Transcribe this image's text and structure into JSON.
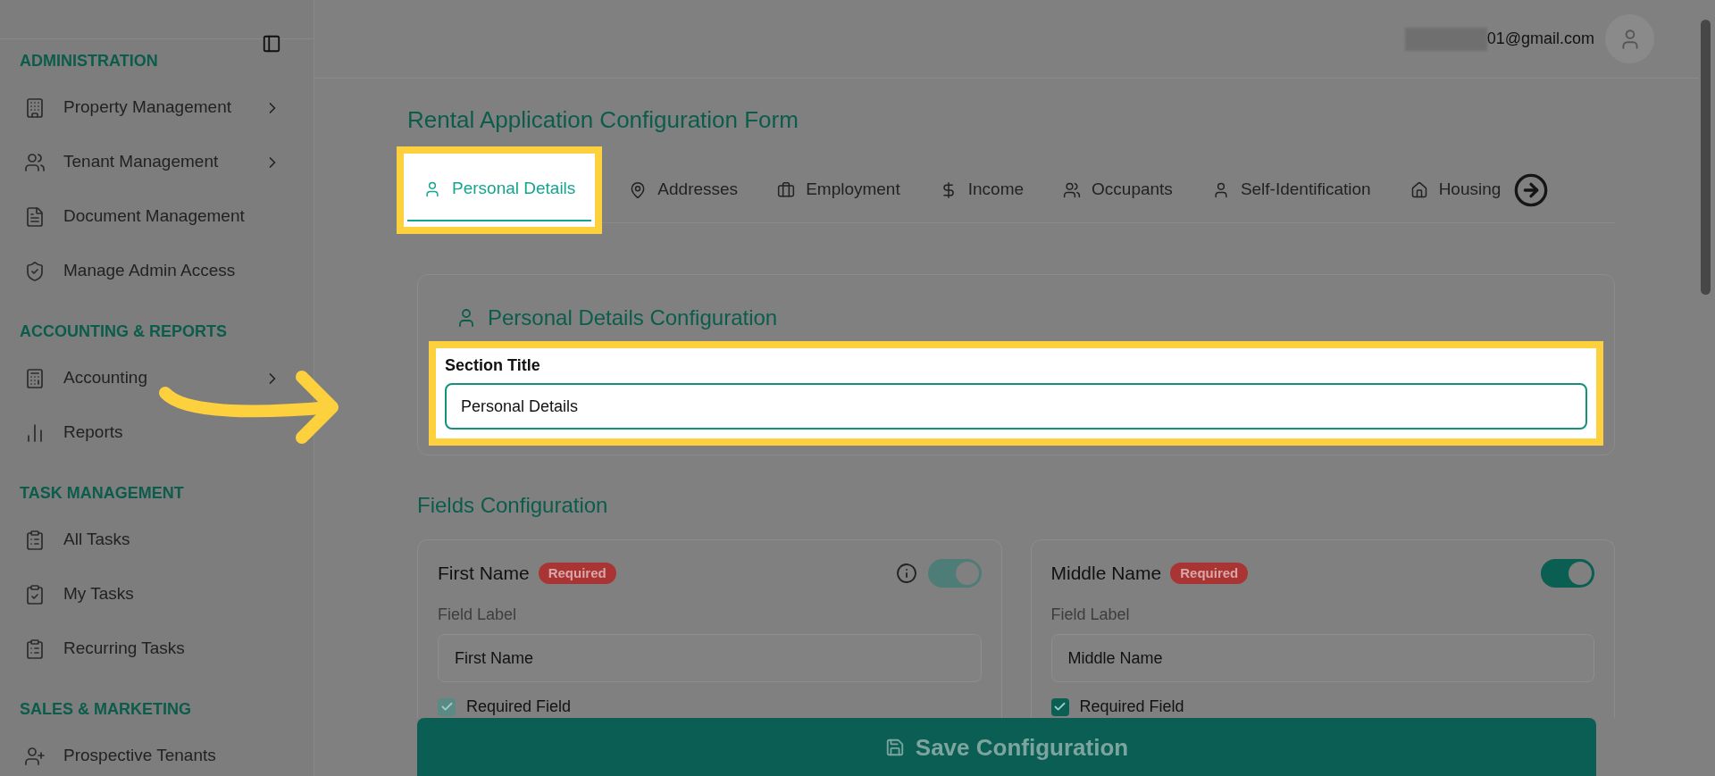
{
  "sidebar": {
    "sections": [
      {
        "heading": "ADMINISTRATION",
        "items": [
          {
            "label": "Property Management",
            "has_submenu": true
          },
          {
            "label": "Tenant Management",
            "has_submenu": true
          },
          {
            "label": "Document Management",
            "has_submenu": false
          },
          {
            "label": "Manage Admin Access",
            "has_submenu": false
          }
        ]
      },
      {
        "heading": "ACCOUNTING & REPORTS",
        "items": [
          {
            "label": "Accounting",
            "has_submenu": true
          },
          {
            "label": "Reports",
            "has_submenu": false
          }
        ]
      },
      {
        "heading": "TASK MANAGEMENT",
        "items": [
          {
            "label": "All Tasks",
            "has_submenu": false
          },
          {
            "label": "My Tasks",
            "has_submenu": false
          },
          {
            "label": "Recurring Tasks",
            "has_submenu": false
          }
        ]
      },
      {
        "heading": "SALES & MARKETING",
        "items": [
          {
            "label": "Prospective Tenants",
            "has_submenu": false
          }
        ]
      }
    ]
  },
  "header": {
    "user_email": "01@gmail.com"
  },
  "form": {
    "title": "Rental Application Configuration Form",
    "tabs": [
      {
        "label": "Personal Details",
        "selected": true
      },
      {
        "label": "Addresses",
        "selected": false
      },
      {
        "label": "Employment",
        "selected": false
      },
      {
        "label": "Income",
        "selected": false
      },
      {
        "label": "Occupants",
        "selected": false
      },
      {
        "label": "Self-Identification",
        "selected": false
      },
      {
        "label": "Housing",
        "selected": false
      }
    ],
    "section": {
      "heading": "Personal Details Configuration",
      "field_label": "Section Title",
      "value": "Personal Details",
      "highlighted": true
    },
    "fields_heading": "Fields Configuration",
    "fields": [
      {
        "name": "First Name",
        "badge": "Required",
        "on": true,
        "disabled": true,
        "has_info": true,
        "caption": "Field Label",
        "value": "First Name",
        "required_label": "Required Field",
        "required_checked": true
      },
      {
        "name": "Middle Name",
        "badge": "Required",
        "on": true,
        "disabled": false,
        "has_info": false,
        "caption": "Field Label",
        "value": "Middle Name",
        "required_label": "Required Field",
        "required_checked": true
      }
    ],
    "save_button": "Save Configuration"
  }
}
